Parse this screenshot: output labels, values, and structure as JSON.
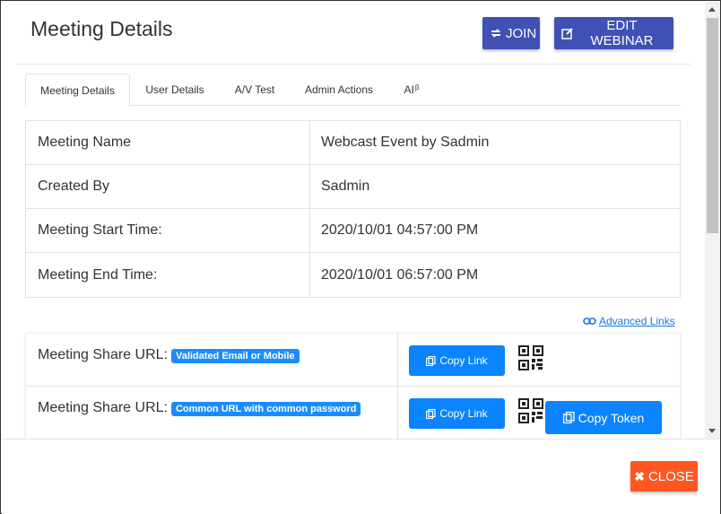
{
  "modal": {
    "title": "Meeting Details",
    "join_label": "JOIN",
    "edit_label": "EDIT WEBINAR",
    "close_label": "CLOSE"
  },
  "tabs": [
    {
      "label": "Meeting Details",
      "active": true
    },
    {
      "label": "User Details"
    },
    {
      "label": "A/V Test"
    },
    {
      "label": "Admin Actions"
    },
    {
      "label": "AI",
      "sup": "β"
    }
  ],
  "details": [
    {
      "label": "Meeting Name",
      "value": "Webcast Event by Sadmin"
    },
    {
      "label": "Created By",
      "value": "Sadmin"
    },
    {
      "label": "Meeting Start Time:",
      "value": "2020/10/01 04:57:00 PM"
    },
    {
      "label": "Meeting End Time:",
      "value": "2020/10/01 06:57:00 PM"
    }
  ],
  "advanced_links_label": "Advanced Links",
  "share_rows": [
    {
      "label": "Meeting Share URL:",
      "badge": "Validated Email or Mobile",
      "copy_label": "Copy Link"
    },
    {
      "label": "Meeting Share URL:",
      "badge": "Common URL with common password",
      "copy_label": "Copy Link",
      "token_label": "Copy Token"
    }
  ],
  "colors": {
    "primary": "#3f51b5",
    "link_blue": "#0a84ff",
    "badge_blue": "#1a8cff",
    "close": "#ff5722"
  }
}
